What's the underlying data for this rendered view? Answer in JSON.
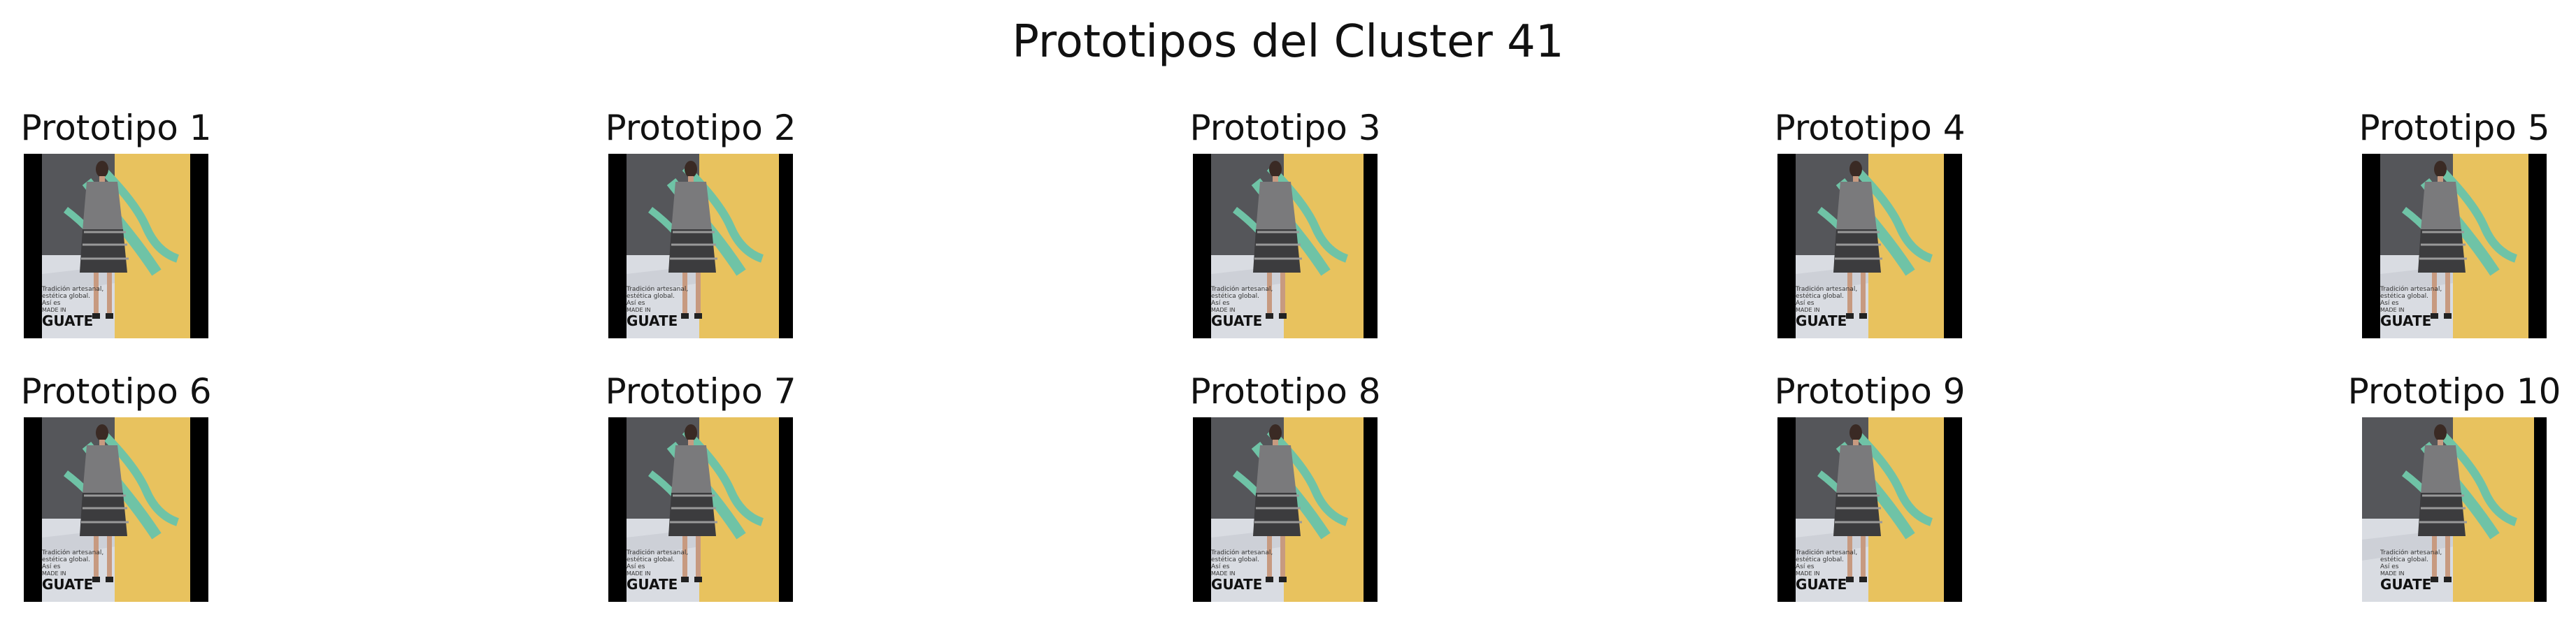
{
  "title": "Prototipos del Cluster 41",
  "prototypes": [
    {
      "label": "Prototipo 1",
      "variant": "a"
    },
    {
      "label": "Prototipo 2",
      "variant": "b"
    },
    {
      "label": "Prototipo 3",
      "variant": "b"
    },
    {
      "label": "Prototipo 4",
      "variant": "a"
    },
    {
      "label": "Prototipo 5",
      "variant": "a"
    },
    {
      "label": "Prototipo 6",
      "variant": "a"
    },
    {
      "label": "Prototipo 7",
      "variant": "b"
    },
    {
      "label": "Prototipo 8",
      "variant": "b"
    },
    {
      "label": "Prototipo 9",
      "variant": "a"
    },
    {
      "label": "Prototipo 10",
      "variant": "c"
    }
  ],
  "poster_text": {
    "line1": "Tradición artesanal,",
    "line2": "estética global.",
    "line3": "Así es",
    "line4": "MADE IN",
    "brand": "GUATE"
  },
  "colors": {
    "yellow": "#E8C25E",
    "teal": "#6FC3A6",
    "black": "#000000",
    "backdrop": "#55565A"
  }
}
